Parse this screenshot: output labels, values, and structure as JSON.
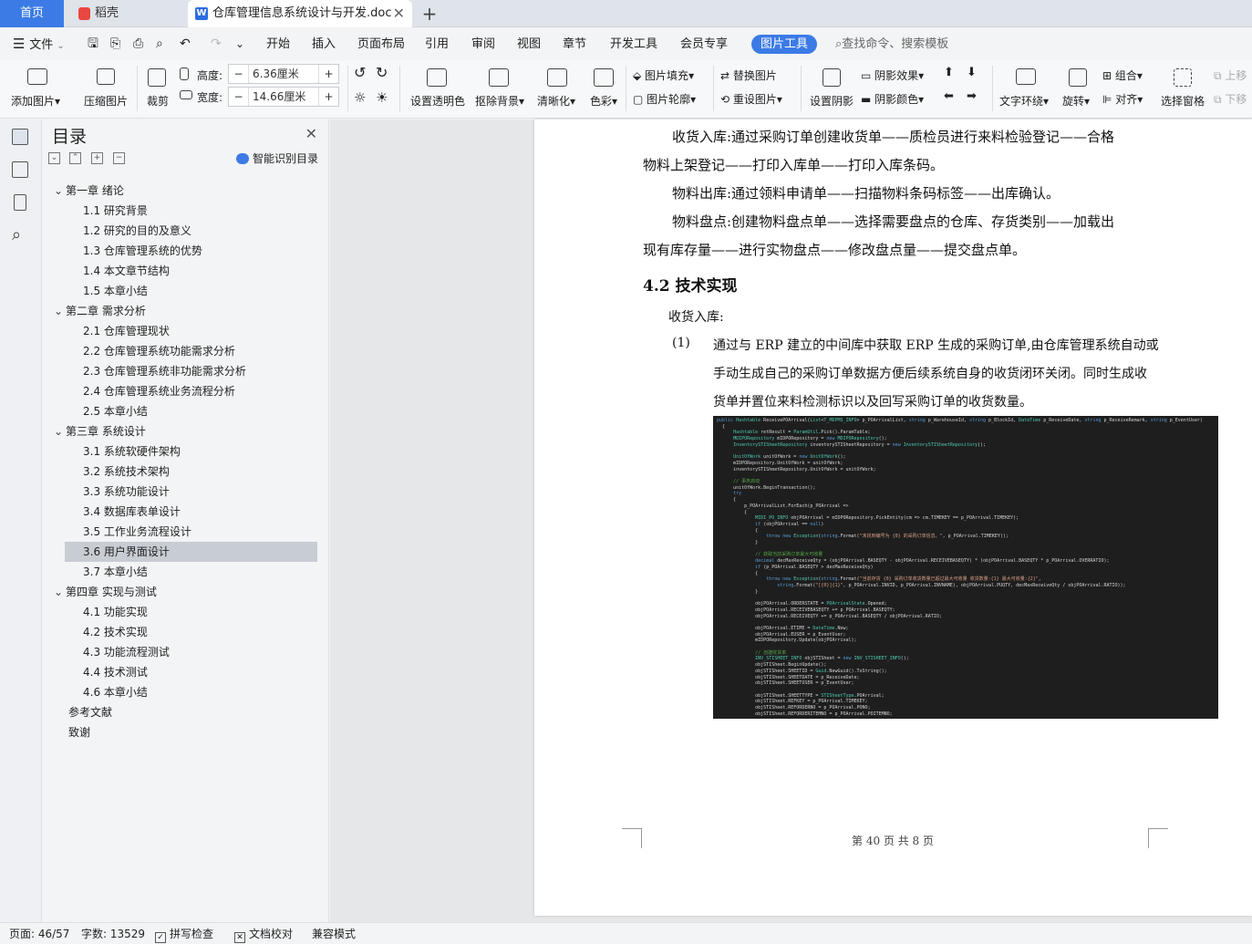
{
  "tabs": {
    "home": "首页",
    "daoke": "稻壳",
    "doc": "仓库管理信息系统设计与开发.doc",
    "add": "+",
    "close": "✕"
  },
  "menu": {
    "file": "文件",
    "items": [
      "开始",
      "插入",
      "页面布局",
      "引用",
      "审阅",
      "视图",
      "章节",
      "开发工具",
      "会员专享"
    ],
    "active": "图片工具",
    "search": "查找命令、搜索模板"
  },
  "ribbon": {
    "add_picture": "添加图片",
    "compress": "压缩图片",
    "crop": "裁剪",
    "height_label": "高度:",
    "height_value": "6.36厘米",
    "width_label": "宽度:",
    "width_value": "14.66厘米",
    "minus": "−",
    "plus": "+",
    "transparent": "设置透明色",
    "remove_bg": "抠除背景",
    "sharpen": "清晰化",
    "color": "色彩",
    "fill": "图片填充",
    "outline": "图片轮廓",
    "replace": "替换图片",
    "reset": "重设图片",
    "shadow": "设置阴影",
    "shadow_effect": "阴影效果",
    "shadow_color": "阴影颜色",
    "wrap": "文字环绕",
    "rotate": "旋转",
    "group": "组合",
    "align": "对齐",
    "select_pane": "选择窗格",
    "up": "上移",
    "down": "下移"
  },
  "toc": {
    "title": "目录",
    "smart": "智能识别目录",
    "items": [
      {
        "text": "第一章  绪论",
        "level": 1
      },
      {
        "text": "1.1  研究背景",
        "level": 2
      },
      {
        "text": "1.2  研究的目的及意义",
        "level": 2
      },
      {
        "text": "1.3  仓库管理系统的优势",
        "level": 2
      },
      {
        "text": "1.4  本文章节结构",
        "level": 2
      },
      {
        "text": "1.5 本章小结",
        "level": 2
      },
      {
        "text": "第二章  需求分析",
        "level": 1
      },
      {
        "text": "2.1  仓库管理现状",
        "level": 2
      },
      {
        "text": "2.2  仓库管理系统功能需求分析",
        "level": 2
      },
      {
        "text": "2.3 仓库管理系统非功能需求分析",
        "level": 2
      },
      {
        "text": "2.4 仓库管理系统业务流程分析",
        "level": 2
      },
      {
        "text": "2.5 本章小结",
        "level": 2
      },
      {
        "text": "第三章  系统设计",
        "level": 1
      },
      {
        "text": "3.1  系统软硬件架构",
        "level": 2
      },
      {
        "text": "3.2  系统技术架构",
        "level": 2
      },
      {
        "text": "3.3 系统功能设计",
        "level": 2
      },
      {
        "text": "3.4 数据库表单设计",
        "level": 2
      },
      {
        "text": "3.5 工作业务流程设计",
        "level": 2
      },
      {
        "text": "3.6  用户界面设计",
        "level": 2
      },
      {
        "text": "3.7 本章小结",
        "level": 2
      },
      {
        "text": "第四章  实现与测试",
        "level": 1
      },
      {
        "text": "4.1  功能实现",
        "level": 2
      },
      {
        "text": "4.2  技术实现",
        "level": 2
      },
      {
        "text": "4.3 功能流程测试",
        "level": 2
      },
      {
        "text": "4.4  技术测试",
        "level": 2
      },
      {
        "text": "4.6 本章小结",
        "level": 2
      },
      {
        "text": "参考文献",
        "level": 0
      },
      {
        "text": "致谢",
        "level": 0
      }
    ],
    "active_index": 18
  },
  "document": {
    "p1a": "收货入库:通过采购订单创建收货单——质检员进行来料检验登记——合格",
    "p1b": "物料上架登记——打印入库单——打印入库条码。",
    "p2": "物料出库:通过领料申请单——扫描物料条码标签——出库确认。",
    "p3a": "物料盘点:创建物料盘点单——选择需要盘点的仓库、存货类别——加载出",
    "p3b": "现有库存量——进行实物盘点——修改盘点量——提交盘点单。",
    "heading": "4.2  技术实现",
    "p4": "收货入库:",
    "list_num": "(1)",
    "l1": "通过与 ERP 建立的中间库中获取 ERP 生成的采购订单,由仓库管理系统自动或",
    "l2": "手动生成自己的采购订单数据方便后续系统自身的收货闭环关闭。同时生成收",
    "l3": "货单并置位来料检测标识以及回写采购订单的收货数量。",
    "footer": "第 40 页 共 8 页"
  },
  "status": {
    "page": "页面: 46/57",
    "words": "字数: 13529",
    "spell": "拼写检查",
    "proof": "文档校对",
    "compat": "兼容模式"
  }
}
